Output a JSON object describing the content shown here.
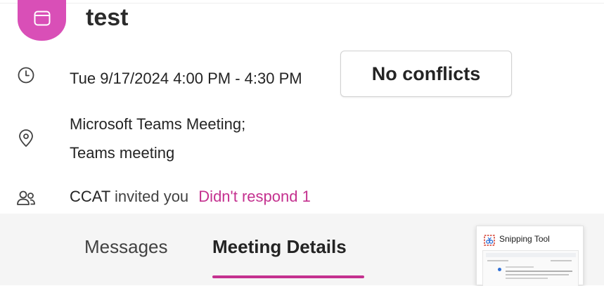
{
  "event": {
    "title": "test",
    "datetime": "Tue 9/17/2024 4:00 PM - 4:30 PM",
    "conflict_status": "No conflicts",
    "location_line1": "Microsoft Teams Meeting;",
    "location_line2": "Teams meeting",
    "organizer": "CCAT",
    "invited_text": "invited you",
    "response_label": "Didn't respond",
    "response_count": "1"
  },
  "tabs": [
    {
      "label": "Messages",
      "active": false
    },
    {
      "label": "Meeting Details",
      "active": true
    }
  ],
  "snipping_tool": {
    "title": "Snipping Tool"
  },
  "colors": {
    "accent": "#c4318f",
    "avatar": "#d94fb7",
    "panel_bg": "#f5f5f5"
  },
  "icons": [
    "calendar-icon",
    "clock-icon",
    "location-icon",
    "people-icon",
    "snipping-tool-icon"
  ]
}
